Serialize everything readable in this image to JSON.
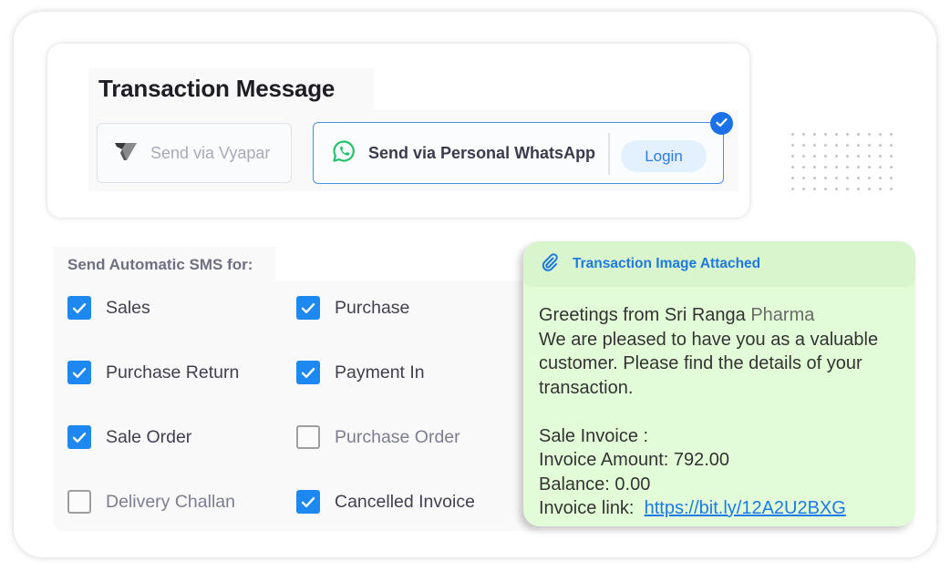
{
  "header": {
    "title": "Transaction Message"
  },
  "send_options": {
    "vyapar": {
      "label": "Send via Vyapar",
      "icon": "vyapar-logo-icon",
      "selected": false
    },
    "whatsapp": {
      "label": "Send via Personal WhatsApp",
      "icon": "whatsapp-icon",
      "selected": true,
      "login_label": "Login",
      "selected_badge_icon": "check-circle-icon"
    }
  },
  "sms_settings": {
    "heading": "Send Automatic SMS for:",
    "items": [
      {
        "label": "Sales",
        "checked": true
      },
      {
        "label": "Purchase",
        "checked": true
      },
      {
        "label": "Purchase Return",
        "checked": true
      },
      {
        "label": "Payment In",
        "checked": true
      },
      {
        "label": "Sale Order",
        "checked": true
      },
      {
        "label": "Purchase Order",
        "checked": false
      },
      {
        "label": "Delivery Challan",
        "checked": false
      },
      {
        "label": "Cancelled Invoice",
        "checked": true
      }
    ]
  },
  "message_preview": {
    "attachment_label": "Transaction Image Attached",
    "attachment_icon": "paperclip-icon",
    "greeting_prefix": "Greetings from Sri Ranga ",
    "greeting_business_suffix": "Pharma",
    "body_line": "We are pleased to have you as a valuable customer. Please find the details of your transaction.",
    "invoice_type": "Sale Invoice :",
    "invoice_amount": "Invoice Amount: 792.00",
    "balance": "Balance: 0.00",
    "link_label": "Invoice link:",
    "link_text": "https://bit.ly/12A2U2BXG"
  },
  "colors": {
    "accent_blue": "#1d88f0",
    "whatsapp_green": "#25c26e",
    "bubble_green": "#e3fcd8",
    "link_blue": "#1a7ae8"
  }
}
